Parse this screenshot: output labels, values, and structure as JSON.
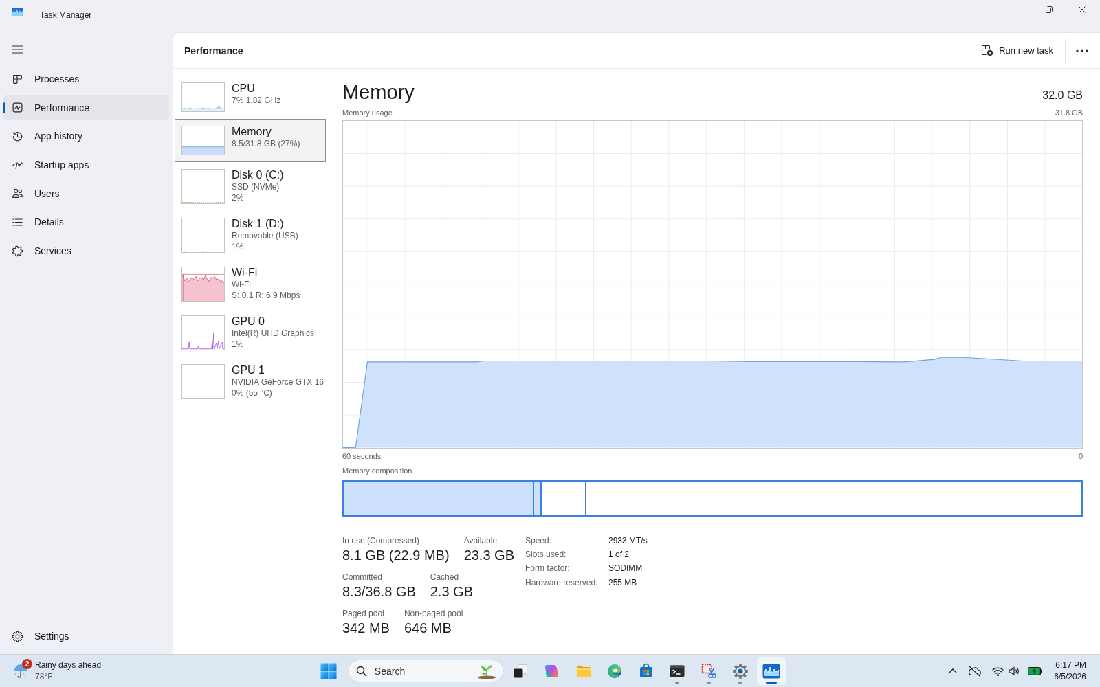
{
  "window": {
    "title": "Task Manager"
  },
  "sidebar": {
    "items": [
      {
        "label": "Processes",
        "selected": false
      },
      {
        "label": "Performance",
        "selected": true
      },
      {
        "label": "App history",
        "selected": false
      },
      {
        "label": "Startup apps",
        "selected": false
      },
      {
        "label": "Users",
        "selected": false
      },
      {
        "label": "Details",
        "selected": false
      },
      {
        "label": "Services",
        "selected": false
      }
    ],
    "footer": [
      {
        "label": "Settings",
        "selected": false
      }
    ]
  },
  "header": {
    "title": "Performance",
    "run_task": "Run new task"
  },
  "devices": [
    {
      "name": "CPU",
      "details": [
        "7% 1.82 GHz"
      ],
      "selected": false
    },
    {
      "name": "Memory",
      "details": [
        "8.5/31.8 GB (27%)"
      ],
      "selected": true
    },
    {
      "name": "Disk 0 (C:)",
      "details": [
        "SSD (NVMe)",
        "2%"
      ],
      "selected": false
    },
    {
      "name": "Disk 1 (D:)",
      "details": [
        "Removable (USB)",
        "1%"
      ],
      "selected": false
    },
    {
      "name": "Wi-Fi",
      "details": [
        "Wi-Fi",
        "S: 0.1 R: 6.9 Mbps"
      ],
      "selected": false
    },
    {
      "name": "GPU 0",
      "details": [
        "Intel(R) UHD Graphics",
        "1%"
      ],
      "selected": false
    },
    {
      "name": "GPU 1",
      "details": [
        "NVIDIA GeForce GTX 16",
        "0% (55 °C)"
      ],
      "selected": false
    }
  ],
  "detail": {
    "title": "Memory",
    "total": "32.0 GB",
    "usage_graph": {
      "label": "Memory usage",
      "max_label": "31.8 GB",
      "start_label": "60 seconds",
      "end_label": "0"
    },
    "composition": {
      "label": "Memory composition"
    },
    "stat_rows": [
      [
        {
          "label": "In use (Compressed)",
          "value": "8.1 GB (22.9 MB)"
        },
        {
          "label": "Available",
          "value": "23.3 GB"
        }
      ],
      [
        {
          "label": "Committed",
          "value": "8.3/36.8 GB"
        },
        {
          "label": "Cached",
          "value": "2.3 GB"
        }
      ],
      [
        {
          "label": "Paged pool",
          "value": "342 MB"
        },
        {
          "label": "Non-paged pool",
          "value": "646 MB"
        }
      ]
    ],
    "specs": [
      {
        "label": "Speed:",
        "value": "2933 MT/s"
      },
      {
        "label": "Slots used:",
        "value": "1 of 2"
      },
      {
        "label": "Form factor:",
        "value": "SODIMM"
      },
      {
        "label": "Hardware reserved:",
        "value": "255 MB"
      }
    ]
  },
  "taskbar": {
    "weather": {
      "badge": "2",
      "title": "Rainy days ahead",
      "temperature": "78°F"
    },
    "search": {
      "placeholder": "Search"
    },
    "apps": [
      {
        "kind": "task_view",
        "running": false,
        "selected": false
      },
      {
        "kind": "office",
        "running": false,
        "selected": false
      },
      {
        "kind": "folder",
        "running": false,
        "selected": false
      },
      {
        "kind": "browser",
        "running": false,
        "selected": false
      },
      {
        "kind": "store",
        "running": false,
        "selected": false
      },
      {
        "kind": "terminal",
        "running": true,
        "selected": false
      },
      {
        "kind": "snipping",
        "running": true,
        "selected": false
      },
      {
        "kind": "settings",
        "running": true,
        "selected": false
      },
      {
        "kind": "task_manager",
        "running": true,
        "selected": true
      }
    ],
    "clock": {
      "time": "6:17 PM",
      "date": "6/5/2026"
    }
  }
}
